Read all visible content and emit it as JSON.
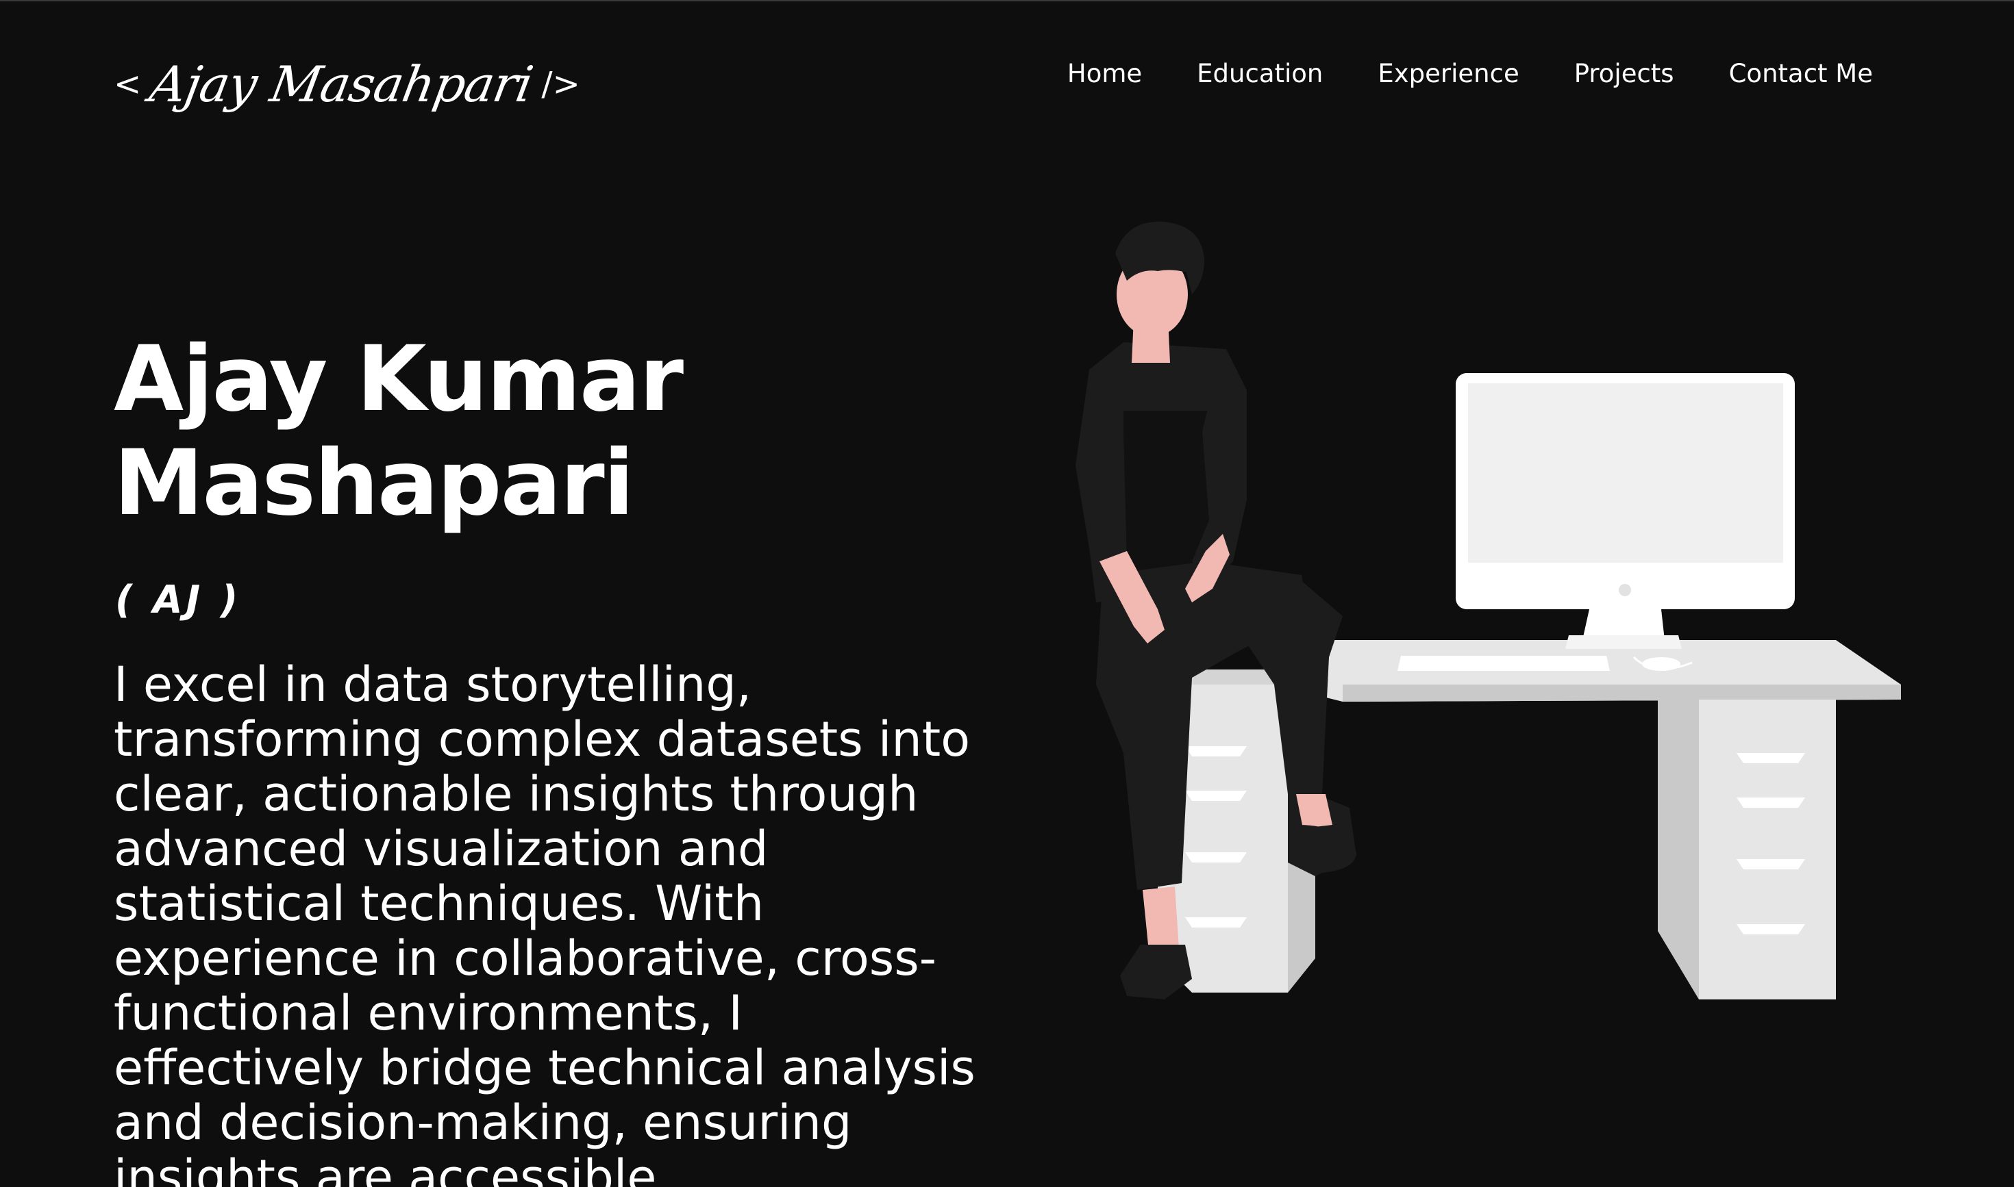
{
  "header": {
    "logo": {
      "open_bracket": "<",
      "signature": "Ajay Masahpari",
      "close_bracket": "/>"
    },
    "nav": [
      {
        "label": "Home"
      },
      {
        "label": "Education"
      },
      {
        "label": "Experience"
      },
      {
        "label": "Projects"
      },
      {
        "label": "Contact Me"
      }
    ]
  },
  "hero": {
    "name_line1": "Ajay Kumar",
    "name_line2": "Mashapari",
    "nickname": "( AJ )",
    "bio": "I excel in data storytelling, transforming complex datasets into clear, actionable insights through advanced visualization and statistical techniques. With experience in collaborative, cross-functional environments, I effectively bridge technical analysis and decision-making, ensuring insights are accessible"
  },
  "colors": {
    "background": "#0e0e0e",
    "text": "#ffffff",
    "skin": "#f2b9b3",
    "clothes": "#1c1c1c",
    "desk": "#e6e6e6",
    "desk_shadow": "#c9c9c9",
    "monitor": "#ffffff",
    "screen": "#f0f0f0"
  }
}
